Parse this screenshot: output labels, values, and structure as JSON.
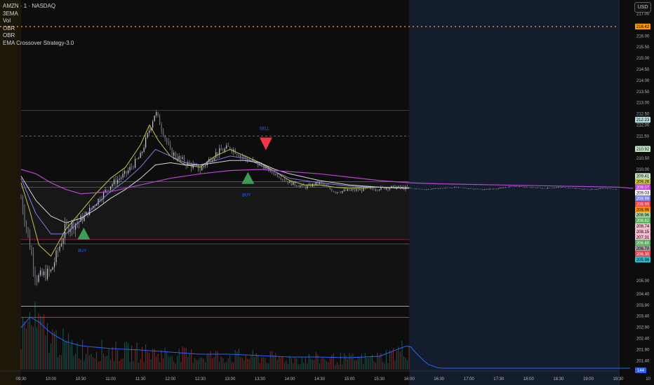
{
  "header": {
    "symbol_line": "AMZN · 1 · NASDAQ",
    "indicators": [
      "3EMA",
      "Vol",
      "OBR",
      "OBR",
      "EMA Crossover Strategy-3.0"
    ],
    "currency_button": "USD"
  },
  "colors": {
    "background": "#0d0d0d",
    "post_market_bg": "#141d2e",
    "pre_market_bg": "#1c1708",
    "ema_fast": "#c8c34a",
    "ema_mid": "#7b7fe0",
    "ema_slow": "#d6d6d6",
    "ema_long": "#b845d4",
    "volume_line": "#2962ff",
    "buy_marker": "#3d9b52",
    "sell_marker": "#f23645",
    "dotted_line": "#ff9800"
  },
  "chart_data": {
    "type": "line",
    "x_tick_labels": [
      "09:30",
      "10:00",
      "10:30",
      "11:00",
      "11:30",
      "12:00",
      "12:30",
      "13:00",
      "13:30",
      "14:00",
      "14:30",
      "15:00",
      "15:30",
      "16:00",
      "16:30",
      "17:00",
      "17:30",
      "18:00",
      "18:30",
      "19:00",
      "19:30",
      "10"
    ],
    "y_tick_labels": [
      "217.00",
      "216.00",
      "215.50",
      "215.00",
      "214.50",
      "214.00",
      "213.50",
      "213.00",
      "212.50",
      "212.00",
      "211.50",
      "210.50",
      "210.00",
      "205.00",
      "204.40",
      "203.90",
      "203.40",
      "202.90",
      "202.40",
      "201.90",
      "201.40"
    ],
    "ylim": [
      201.0,
      217.3
    ],
    "price_series": {
      "name": "AMZN",
      "x": [
        0.0,
        0.5,
        1.0,
        1.5,
        2.0,
        2.5,
        3.0,
        3.5,
        4.0,
        4.5,
        5.0,
        5.5,
        6.0,
        6.5,
        7.0,
        7.5,
        8.0,
        8.5,
        9.0,
        9.5,
        10.0,
        10.5,
        11.0,
        11.5,
        12.0,
        12.5,
        13.0,
        13.5,
        14.0,
        14.5,
        15.0,
        15.5,
        16.0,
        16.5,
        17.0,
        17.5,
        18.0,
        18.5,
        19.0,
        19.5,
        20.0,
        20.5
      ],
      "y": [
        208.7,
        205.1,
        205.4,
        207.4,
        207.7,
        208.5,
        209.3,
        209.8,
        210.6,
        212.6,
        210.8,
        210.3,
        210.0,
        210.7,
        211.0,
        210.5,
        210.2,
        209.8,
        209.4,
        209.2,
        209.4,
        209.0,
        209.05,
        209.1,
        209.15,
        209.2,
        209.15,
        209.1,
        209.15,
        209.2,
        209.15,
        209.1,
        209.15,
        209.25,
        209.2,
        209.15,
        209.2,
        209.15,
        209.1,
        209.15,
        209.1,
        209.05
      ]
    },
    "ema_series": [
      {
        "name": "3EMA",
        "x": [
          0.0,
          0.3,
          0.6,
          1.0,
          1.5,
          2.0,
          2.5,
          3.0,
          3.5,
          4.0,
          4.3,
          4.6,
          5.0,
          5.5,
          6.0,
          6.5,
          7.0,
          7.5,
          8.0,
          8.5,
          9.0,
          9.5,
          10.0,
          10.5,
          11.0,
          12.0,
          13.0
        ],
        "y": [
          209.4,
          208.1,
          206.6,
          206.1,
          207.3,
          208.1,
          208.9,
          209.6,
          210.1,
          211.1,
          212.0,
          211.3,
          210.6,
          210.2,
          210.1,
          210.6,
          210.9,
          210.6,
          210.3,
          209.9,
          209.5,
          209.3,
          209.3,
          209.2,
          209.15,
          209.2,
          209.15
        ]
      },
      {
        "name": "3EMA",
        "x": [
          0.0,
          0.5,
          1.0,
          1.5,
          2.0,
          2.5,
          3.0,
          3.5,
          4.0,
          4.5,
          5.0,
          5.5,
          6.0,
          6.5,
          7.0,
          7.5,
          8.0,
          8.5,
          9.0,
          10.0,
          11.0,
          12.0,
          13.0
        ],
        "y": [
          209.6,
          208.0,
          207.1,
          207.1,
          207.7,
          208.4,
          209.0,
          209.5,
          210.1,
          210.9,
          210.6,
          210.3,
          210.2,
          210.4,
          210.6,
          210.5,
          210.2,
          209.9,
          209.6,
          209.4,
          209.25,
          209.2,
          209.15
        ]
      },
      {
        "name": "3EMA",
        "x": [
          0.0,
          0.5,
          1.0,
          1.5,
          2.0,
          2.5,
          3.0,
          3.5,
          4.0,
          4.5,
          5.0,
          5.5,
          6.0,
          6.5,
          7.0,
          7.5,
          8.0,
          8.5,
          9.0,
          10.0,
          11.0,
          12.0,
          13.0
        ],
        "y": [
          209.7,
          208.6,
          207.9,
          207.6,
          207.8,
          208.2,
          208.7,
          209.1,
          209.6,
          210.2,
          210.3,
          210.2,
          210.2,
          210.3,
          210.4,
          210.4,
          210.3,
          210.0,
          209.8,
          209.5,
          209.3,
          209.2,
          209.15
        ]
      },
      {
        "name": "3EMA",
        "x": [
          0.0,
          0.5,
          1.0,
          1.5,
          2.0,
          3.0,
          4.0,
          5.0,
          6.0,
          7.0,
          8.0,
          9.0,
          10.0,
          11.0,
          12.0,
          13.0,
          14.0,
          16.0,
          18.0,
          20.0,
          20.5
        ],
        "y": [
          210.0,
          209.8,
          209.4,
          209.1,
          208.9,
          209.0,
          209.3,
          209.6,
          209.8,
          209.95,
          210.0,
          209.9,
          209.8,
          209.65,
          209.5,
          209.4,
          209.35,
          209.3,
          209.25,
          209.2,
          209.15
        ]
      }
    ],
    "horizontal_levels": [
      {
        "y": 216.42,
        "style": "dotted",
        "color": "#ff9800"
      },
      {
        "y": 212.65,
        "style": "solid",
        "color": "#555555"
      },
      {
        "y": 211.5,
        "style": "dashed",
        "color": "#777777"
      },
      {
        "y": 209.45,
        "style": "solid",
        "color": "#f23645"
      },
      {
        "y": 209.2,
        "style": "solid",
        "color": "#666666"
      },
      {
        "y": 206.85,
        "style": "solid",
        "color": "#c2185b"
      },
      {
        "y": 206.65,
        "style": "solid",
        "color": "#555555"
      },
      {
        "y": 203.85,
        "style": "solid",
        "color": "#c8c34a"
      },
      {
        "y": 203.35,
        "style": "solid",
        "color": "#f23645"
      }
    ],
    "signals": [
      {
        "type": "buy",
        "x": 2.1,
        "y": 207.1,
        "label": "BUY"
      },
      {
        "type": "buy",
        "x": 7.6,
        "y": 209.6,
        "label": "BUY"
      },
      {
        "type": "sell",
        "x": 8.2,
        "y": 211.15,
        "label": "SELL"
      }
    ],
    "price_tags": [
      {
        "label": "216.42",
        "y": 216.42,
        "bg": "#ff9800",
        "fg": "#000000"
      },
      {
        "label": "212.23",
        "y": 212.23,
        "bg": "#b2dfdb",
        "fg": "#000000"
      },
      {
        "label": "210.92",
        "y": 210.92,
        "bg": "#c8e6c9",
        "fg": "#000000"
      },
      {
        "label": "209.41",
        "y": 209.7,
        "bg": "#c8e6c9",
        "fg": "#000000"
      },
      {
        "label": "209.26",
        "y": 209.45,
        "bg": "#c8c34a",
        "fg": "#000000"
      },
      {
        "label": "209.07",
        "y": 209.2,
        "bg": "#b845d4",
        "fg": "#ffffff"
      },
      {
        "label": "209.03",
        "y": 208.95,
        "bg": "#ffffff",
        "fg": "#000000"
      },
      {
        "label": "208.99",
        "y": 208.7,
        "bg": "#7b7fe0",
        "fg": "#ffffff"
      },
      {
        "label": "208.99",
        "y": 208.45,
        "bg": "#f23645",
        "fg": "#ffffff"
      },
      {
        "label": "208.96",
        "y": 208.2,
        "bg": "#ff9800",
        "fg": "#000000"
      },
      {
        "label": "208.96",
        "y": 207.95,
        "bg": "#a5d6a7",
        "fg": "#000000"
      },
      {
        "label": "208.82",
        "y": 207.7,
        "bg": "#4caf50",
        "fg": "#ffffff"
      },
      {
        "label": "208.74",
        "y": 207.45,
        "bg": "#f8bbd0",
        "fg": "#000000"
      },
      {
        "label": "208.15",
        "y": 207.2,
        "bg": "#f8bbd0",
        "fg": "#000000"
      },
      {
        "label": "207.31",
        "y": 206.95,
        "bg": "#f8bbd0",
        "fg": "#000000"
      },
      {
        "label": "206.80",
        "y": 206.7,
        "bg": "#4caf50",
        "fg": "#ffffff"
      },
      {
        "label": "206.70",
        "y": 206.45,
        "bg": "#9e9e9e",
        "fg": "#000000"
      },
      {
        "label": "206.30",
        "y": 206.2,
        "bg": "#f23645",
        "fg": "#ffffff"
      },
      {
        "label": "205.96",
        "y": 205.95,
        "bg": "#26c6da",
        "fg": "#000000"
      }
    ],
    "volume_tag": {
      "label": "144",
      "bg": "#2962ff",
      "fg": "#ffffff"
    }
  }
}
